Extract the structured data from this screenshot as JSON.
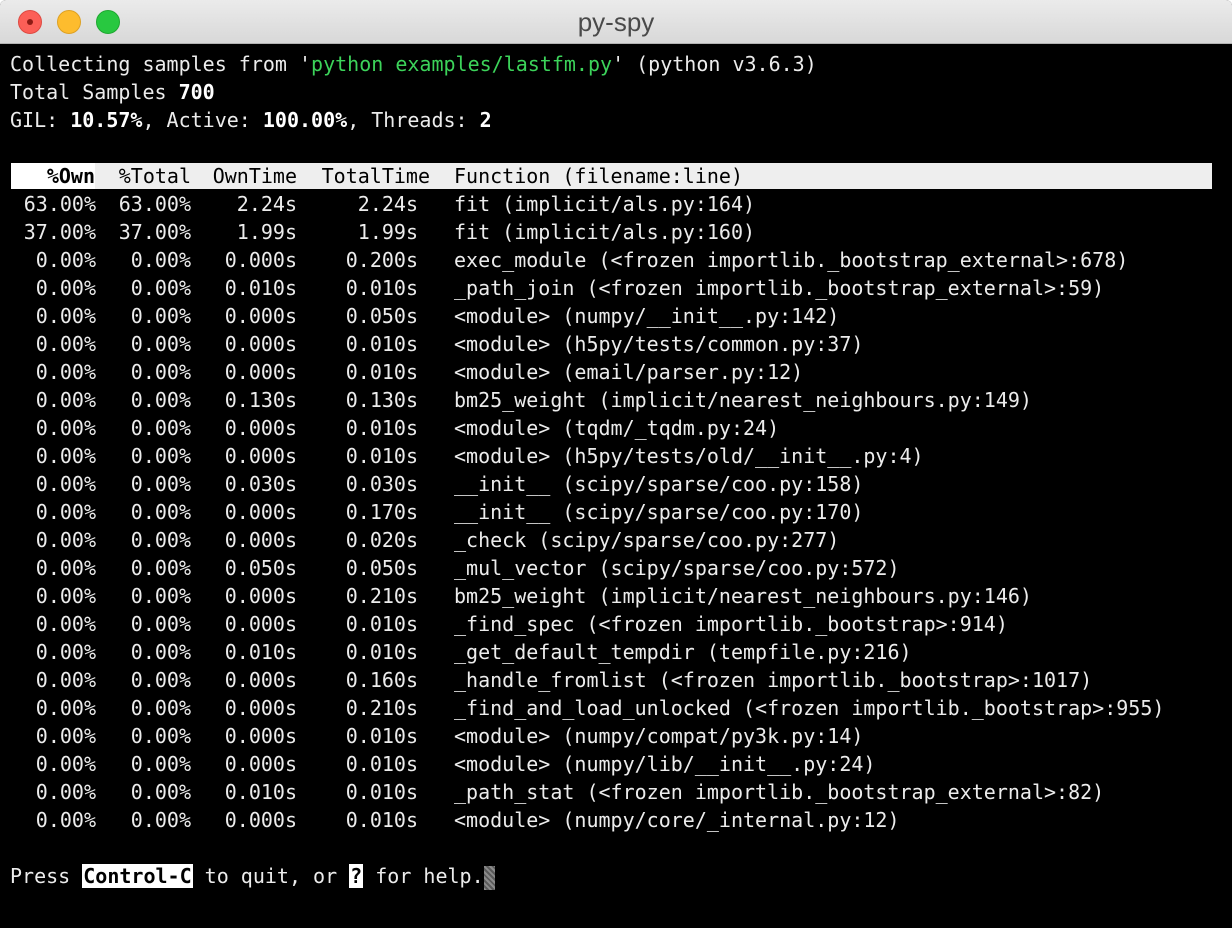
{
  "window": {
    "title": "py-spy"
  },
  "status": {
    "collecting_prefix": "Collecting samples from '",
    "command": "python examples/lastfm.py",
    "collecting_suffix": "' (python v3.6.3)",
    "total_label": "Total Samples ",
    "total_value": "700",
    "gil_label": "GIL: ",
    "gil_value": "10.57%",
    "active_label": ", Active: ",
    "active_value": "100.00%",
    "threads_label": ", Threads: ",
    "threads_value": "2"
  },
  "table": {
    "headers": {
      "own": "%Own",
      "total": "%Total",
      "owntime": "OwnTime",
      "totaltime": "TotalTime",
      "function": "Function (filename:line)"
    },
    "sorted_by": "own",
    "rows": [
      {
        "own": "63.00%",
        "total": "63.00%",
        "owntime": "2.24s",
        "totaltime": "2.24s",
        "function": "fit (implicit/als.py:164)"
      },
      {
        "own": "37.00%",
        "total": "37.00%",
        "owntime": "1.99s",
        "totaltime": "1.99s",
        "function": "fit (implicit/als.py:160)"
      },
      {
        "own": "0.00%",
        "total": "0.00%",
        "owntime": "0.000s",
        "totaltime": "0.200s",
        "function": "exec_module (<frozen importlib._bootstrap_external>:678)"
      },
      {
        "own": "0.00%",
        "total": "0.00%",
        "owntime": "0.010s",
        "totaltime": "0.010s",
        "function": "_path_join (<frozen importlib._bootstrap_external>:59)"
      },
      {
        "own": "0.00%",
        "total": "0.00%",
        "owntime": "0.000s",
        "totaltime": "0.050s",
        "function": "<module> (numpy/__init__.py:142)"
      },
      {
        "own": "0.00%",
        "total": "0.00%",
        "owntime": "0.000s",
        "totaltime": "0.010s",
        "function": "<module> (h5py/tests/common.py:37)"
      },
      {
        "own": "0.00%",
        "total": "0.00%",
        "owntime": "0.000s",
        "totaltime": "0.010s",
        "function": "<module> (email/parser.py:12)"
      },
      {
        "own": "0.00%",
        "total": "0.00%",
        "owntime": "0.130s",
        "totaltime": "0.130s",
        "function": "bm25_weight (implicit/nearest_neighbours.py:149)"
      },
      {
        "own": "0.00%",
        "total": "0.00%",
        "owntime": "0.000s",
        "totaltime": "0.010s",
        "function": "<module> (tqdm/_tqdm.py:24)"
      },
      {
        "own": "0.00%",
        "total": "0.00%",
        "owntime": "0.000s",
        "totaltime": "0.010s",
        "function": "<module> (h5py/tests/old/__init__.py:4)"
      },
      {
        "own": "0.00%",
        "total": "0.00%",
        "owntime": "0.030s",
        "totaltime": "0.030s",
        "function": "__init__ (scipy/sparse/coo.py:158)"
      },
      {
        "own": "0.00%",
        "total": "0.00%",
        "owntime": "0.000s",
        "totaltime": "0.170s",
        "function": "__init__ (scipy/sparse/coo.py:170)"
      },
      {
        "own": "0.00%",
        "total": "0.00%",
        "owntime": "0.000s",
        "totaltime": "0.020s",
        "function": "_check (scipy/sparse/coo.py:277)"
      },
      {
        "own": "0.00%",
        "total": "0.00%",
        "owntime": "0.050s",
        "totaltime": "0.050s",
        "function": "_mul_vector (scipy/sparse/coo.py:572)"
      },
      {
        "own": "0.00%",
        "total": "0.00%",
        "owntime": "0.000s",
        "totaltime": "0.210s",
        "function": "bm25_weight (implicit/nearest_neighbours.py:146)"
      },
      {
        "own": "0.00%",
        "total": "0.00%",
        "owntime": "0.000s",
        "totaltime": "0.010s",
        "function": "_find_spec (<frozen importlib._bootstrap>:914)"
      },
      {
        "own": "0.00%",
        "total": "0.00%",
        "owntime": "0.010s",
        "totaltime": "0.010s",
        "function": "_get_default_tempdir (tempfile.py:216)"
      },
      {
        "own": "0.00%",
        "total": "0.00%",
        "owntime": "0.000s",
        "totaltime": "0.160s",
        "function": "_handle_fromlist (<frozen importlib._bootstrap>:1017)"
      },
      {
        "own": "0.00%",
        "total": "0.00%",
        "owntime": "0.000s",
        "totaltime": "0.210s",
        "function": "_find_and_load_unlocked (<frozen importlib._bootstrap>:955)"
      },
      {
        "own": "0.00%",
        "total": "0.00%",
        "owntime": "0.000s",
        "totaltime": "0.010s",
        "function": "<module> (numpy/compat/py3k.py:14)"
      },
      {
        "own": "0.00%",
        "total": "0.00%",
        "owntime": "0.000s",
        "totaltime": "0.010s",
        "function": "<module> (numpy/lib/__init__.py:24)"
      },
      {
        "own": "0.00%",
        "total": "0.00%",
        "owntime": "0.010s",
        "totaltime": "0.010s",
        "function": "_path_stat (<frozen importlib._bootstrap_external>:82)"
      },
      {
        "own": "0.00%",
        "total": "0.00%",
        "owntime": "0.000s",
        "totaltime": "0.010s",
        "function": "<module> (numpy/core/_internal.py:12)"
      }
    ]
  },
  "footer": {
    "press": "Press ",
    "key_quit": "Control-C",
    "middle": " to quit, or ",
    "key_help": "?",
    "end": " for help."
  },
  "colors": {
    "command": "#3cd35a",
    "background": "#000000",
    "foreground": "#ececec",
    "header_bg": "#eeeeee"
  }
}
